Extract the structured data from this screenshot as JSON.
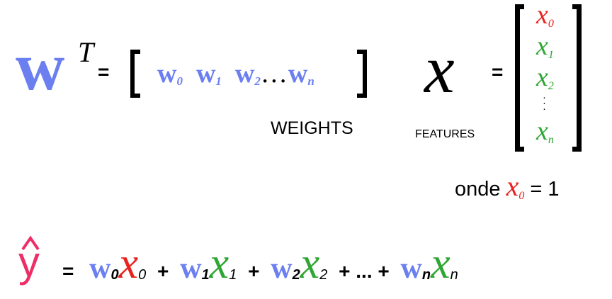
{
  "colors": {
    "weight": "#6b7ff0",
    "x0": "#e8231f",
    "feature": "#2fa633",
    "yhat": "#ee2f67",
    "text": "#000000"
  },
  "weights_eq": {
    "w": "w",
    "superscript": "T",
    "equals": "=",
    "row": [
      {
        "base": "w",
        "sub": "0"
      },
      {
        "base": "w",
        "sub": "1"
      },
      {
        "base": "w",
        "sub": "2"
      },
      {
        "base": "w",
        "sub": "n"
      }
    ],
    "ellipsis": "…",
    "label": "WEIGHTS"
  },
  "features_eq": {
    "x": "x",
    "equals": "=",
    "label": "FEATURES",
    "column": [
      {
        "base": "x",
        "sub": "0"
      },
      {
        "base": "x",
        "sub": "1"
      },
      {
        "base": "x",
        "sub": "2"
      },
      {
        "base": "x",
        "sub": "n"
      }
    ],
    "vdots": "⋮"
  },
  "note": {
    "prefix": "onde",
    "x": "x",
    "sub": "0",
    "suffix": "= 1"
  },
  "prediction": {
    "y": "y",
    "equals": "=",
    "terms": [
      {
        "w": "w",
        "wsub": "0",
        "x": "x",
        "xsub": "0"
      },
      {
        "w": "w",
        "wsub": "1",
        "x": "x",
        "xsub": "1"
      },
      {
        "w": "w",
        "wsub": "2",
        "x": "x",
        "xsub": "2"
      },
      {
        "w": "w",
        "wsub": "n",
        "x": "x",
        "xsub": "n"
      }
    ],
    "plus": "+",
    "ellipsis": "..."
  }
}
